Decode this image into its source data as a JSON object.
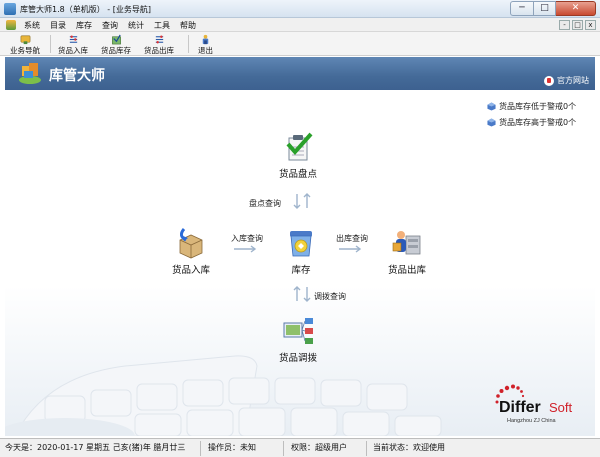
{
  "window": {
    "title": "库管大师1.8（单机版） - [业务导航]",
    "min_label": "─",
    "max_label": "□",
    "close_label": "✕"
  },
  "menu": {
    "items": [
      "系统",
      "目录",
      "库存",
      "查询",
      "统计",
      "工具",
      "帮助"
    ],
    "mdi_min": "-",
    "mdi_max": "□",
    "mdi_close": "x"
  },
  "toolbar": {
    "buttons": [
      {
        "label": "业务导航",
        "icon": "navigation-icon"
      },
      {
        "label": "货品入库",
        "icon": "stock-in-icon"
      },
      {
        "label": "货品库存",
        "icon": "inventory-icon"
      },
      {
        "label": "货品出库",
        "icon": "stock-out-icon"
      },
      {
        "label": "退出",
        "icon": "exit-icon"
      }
    ]
  },
  "banner": {
    "title": "库管大师",
    "site_link": "官方网站"
  },
  "alerts": [
    "货品库存低于警戒0个",
    "货品库存高于警戒0个"
  ],
  "flow": {
    "check": "货品盘点",
    "stock_in": "货品入库",
    "inventory": "库存",
    "stock_out": "货品出库",
    "transfer": "货品调拨",
    "check_query": "盘点查询",
    "in_query": "入库查询",
    "out_query": "出库查询",
    "transfer_query": "调拨查询"
  },
  "brand": {
    "name_a": "Differ",
    "name_b": "Soft",
    "tagline": "Hangzhou ZJ China"
  },
  "status": {
    "date": "今天是：2020-01-17 星期五 己亥(猪)年 腊月廿三",
    "operator": "操作员：未知",
    "permission": "权限：超级用户",
    "state": "当前状态：欢迎使用"
  },
  "colors": {
    "banner": "#4a6f9c",
    "accent_red": "#d0212a",
    "arrow": "#9fb4cc"
  }
}
